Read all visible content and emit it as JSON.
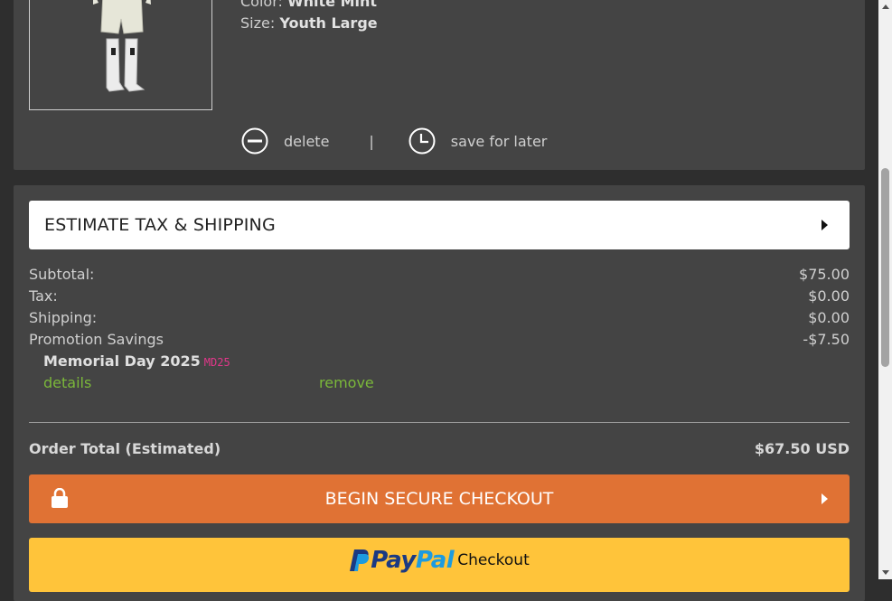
{
  "product": {
    "color_label": "Color:",
    "color_value": "White Mint",
    "size_label": "Size:",
    "size_value": "Youth Large",
    "image_icon": "uniform-product-image"
  },
  "item_actions": {
    "delete_label": "delete",
    "separator": "|",
    "save_label": "save for later",
    "delete_icon": "minus-circle-icon",
    "save_icon": "clock-icon"
  },
  "summary": {
    "estimate_label": "ESTIMATE TAX & SHIPPING",
    "rows": [
      {
        "label": "Subtotal:",
        "value": "$75.00"
      },
      {
        "label": "Tax:",
        "value": "$0.00"
      },
      {
        "label": "Shipping:",
        "value": "$0.00"
      },
      {
        "label": "Promotion Savings",
        "value": "-$7.50"
      }
    ],
    "promo_name": "Memorial Day 2025",
    "promo_code": "MD25",
    "details_link": "details",
    "remove_link": "remove",
    "total_label": "Order Total (Estimated)",
    "total_value": "$67.50 USD"
  },
  "checkout": {
    "label": "BEGIN SECURE CHECKOUT",
    "lock_icon": "lock-icon"
  },
  "paypal": {
    "brand_part1": "Pay",
    "brand_part2": "Pal",
    "checkout_label": "Checkout",
    "logo_icon": "paypal-p-icon"
  },
  "colors": {
    "background": "#2e2e2e",
    "panel": "#444444",
    "checkout_orange": "#e07234",
    "paypal_yellow": "#ffc43a",
    "link_green": "#7bb83a",
    "promo_code_pink": "#e2378a"
  }
}
